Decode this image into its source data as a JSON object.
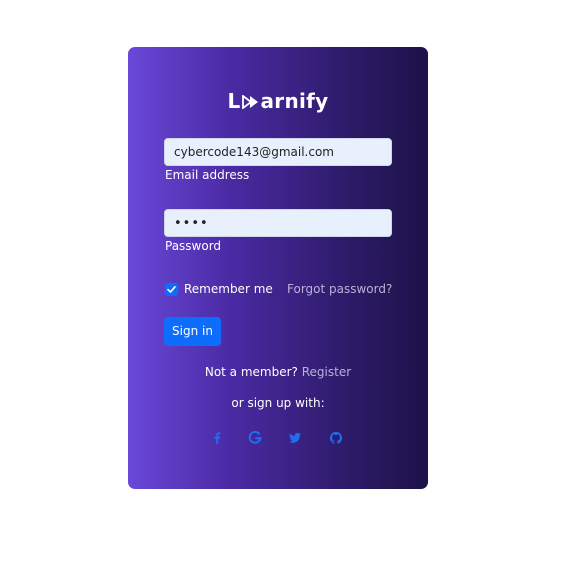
{
  "brand": {
    "prefix": "L",
    "suffix": "arnify"
  },
  "form": {
    "email_value": "cybercode143@gmail.com",
    "email_label": "Email address",
    "password_value": "••••",
    "password_label": "Password",
    "remember_label": "Remember me",
    "remember_checked": true,
    "forgot_label": "Forgot password?",
    "signin_label": "Sign in"
  },
  "footer": {
    "member_text": "Not a member?",
    "register_label": "Register",
    "or_text": "or sign up with:"
  },
  "social": {
    "icons": [
      "facebook-icon",
      "google-icon",
      "twitter-icon",
      "github-icon"
    ],
    "color": "#1f6ef2"
  },
  "colors": {
    "gradient_start": "#6a48d9",
    "gradient_end": "#1d1148",
    "primary": "#0d6efd",
    "input_bg": "#e8f0fe"
  }
}
